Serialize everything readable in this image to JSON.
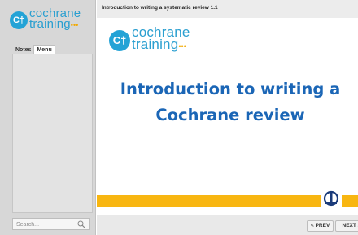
{
  "sidebar": {
    "logo": {
      "mark": "C†",
      "line1": "cochrane",
      "line2": "training",
      "dots": "•••"
    },
    "tabs": [
      {
        "label": "Notes"
      },
      {
        "label": "Menu"
      }
    ],
    "search": {
      "placeholder": "Search...",
      "icon": "search-icon"
    }
  },
  "header": {
    "title": "Introduction to writing a systematic review 1.1"
  },
  "slide": {
    "logo": {
      "mark": "C†",
      "line1": "cochrane",
      "line2": "training",
      "dots": "•••"
    },
    "title": "Introduction to writing a Cochrane review",
    "accent_color": "#f8b611",
    "title_color": "#1b66b6"
  },
  "footer": {
    "prev_label": "< PREV",
    "next_label": "NEXT >"
  }
}
